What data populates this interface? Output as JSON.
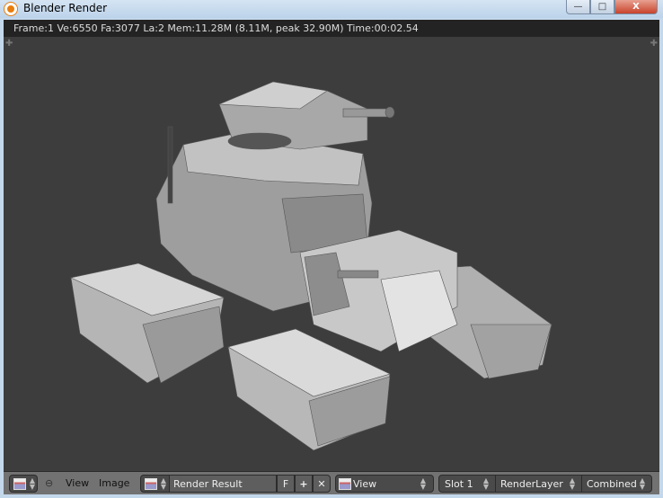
{
  "window": {
    "title": "Blender Render",
    "minimize_label": "—",
    "maximize_label": "□",
    "close_label": "X"
  },
  "info": {
    "text": "Frame:1 Ve:6550 Fa:3077 La:2 Mem:11.28M (8.11M, peak 32.90M) Time:00:02.54"
  },
  "toolbar": {
    "menus": {
      "view": "View",
      "image": "Image"
    },
    "image_name": "Render Result",
    "fake_user": "F",
    "new_label": "+",
    "unlink_label": "✕",
    "display_mode": "View",
    "slot": "Slot 1",
    "layer": "RenderLayer",
    "pass": "Combined"
  }
}
